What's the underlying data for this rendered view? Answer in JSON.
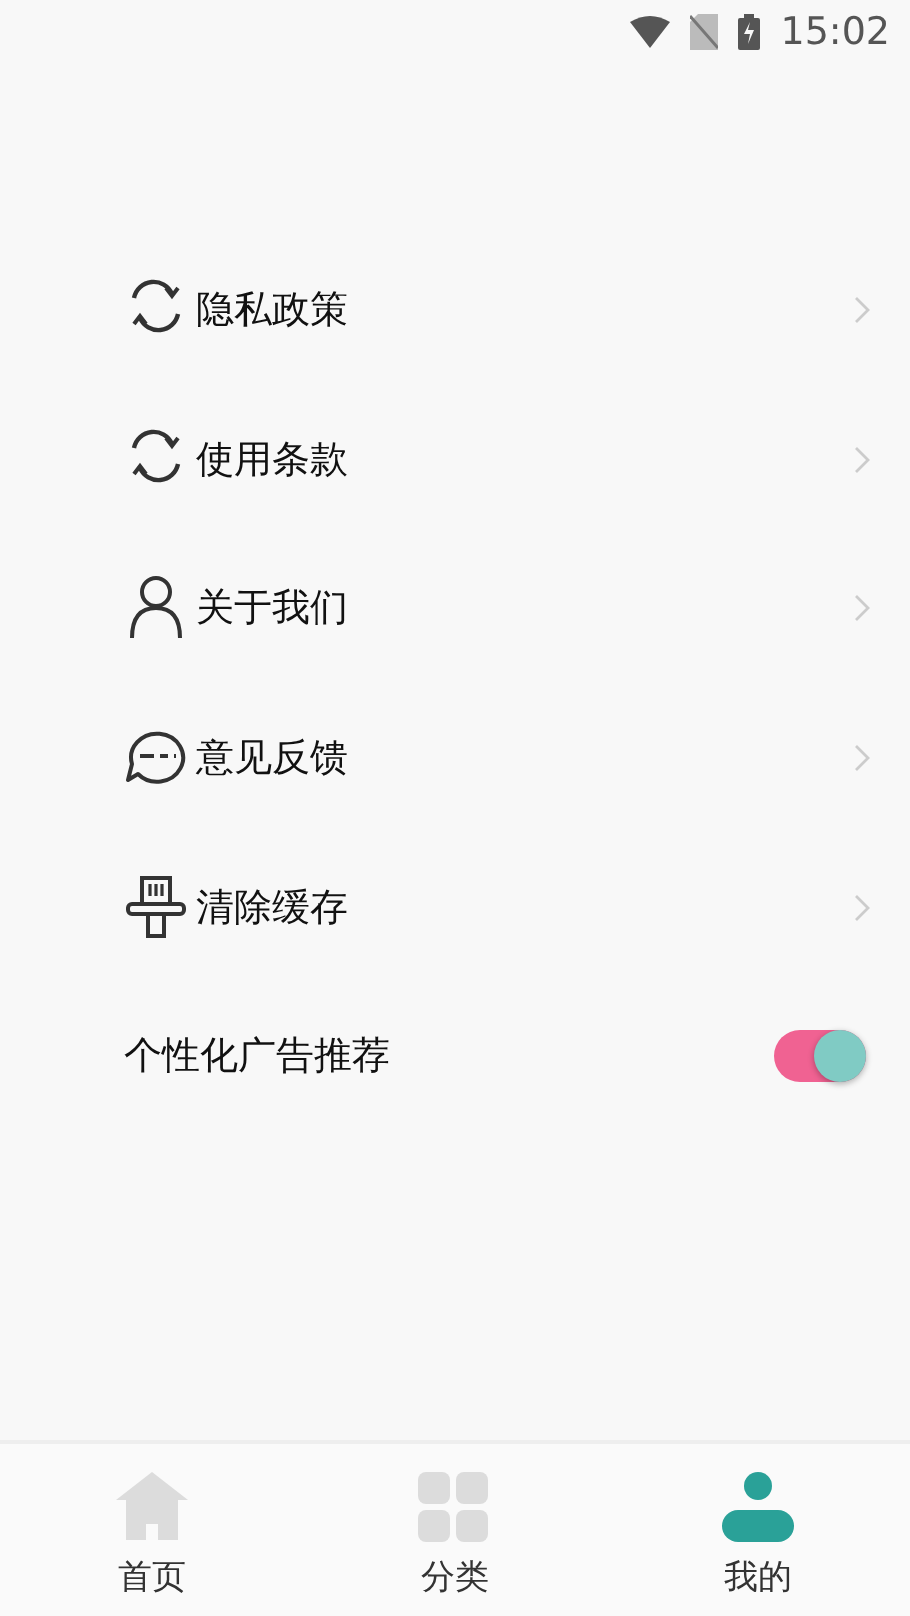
{
  "status_bar": {
    "time": "15:02"
  },
  "menu_items": [
    {
      "label": "隐私政策"
    },
    {
      "label": "使用条款"
    },
    {
      "label": "关于我们"
    },
    {
      "label": "意见反馈"
    },
    {
      "label": "清除缓存"
    }
  ],
  "toggle_row": {
    "label": "个性化广告推荐",
    "on": true
  },
  "bottom_nav": [
    {
      "label": "首页",
      "selected": false
    },
    {
      "label": "分类",
      "selected": false
    },
    {
      "label": "我的",
      "selected": true
    }
  ]
}
